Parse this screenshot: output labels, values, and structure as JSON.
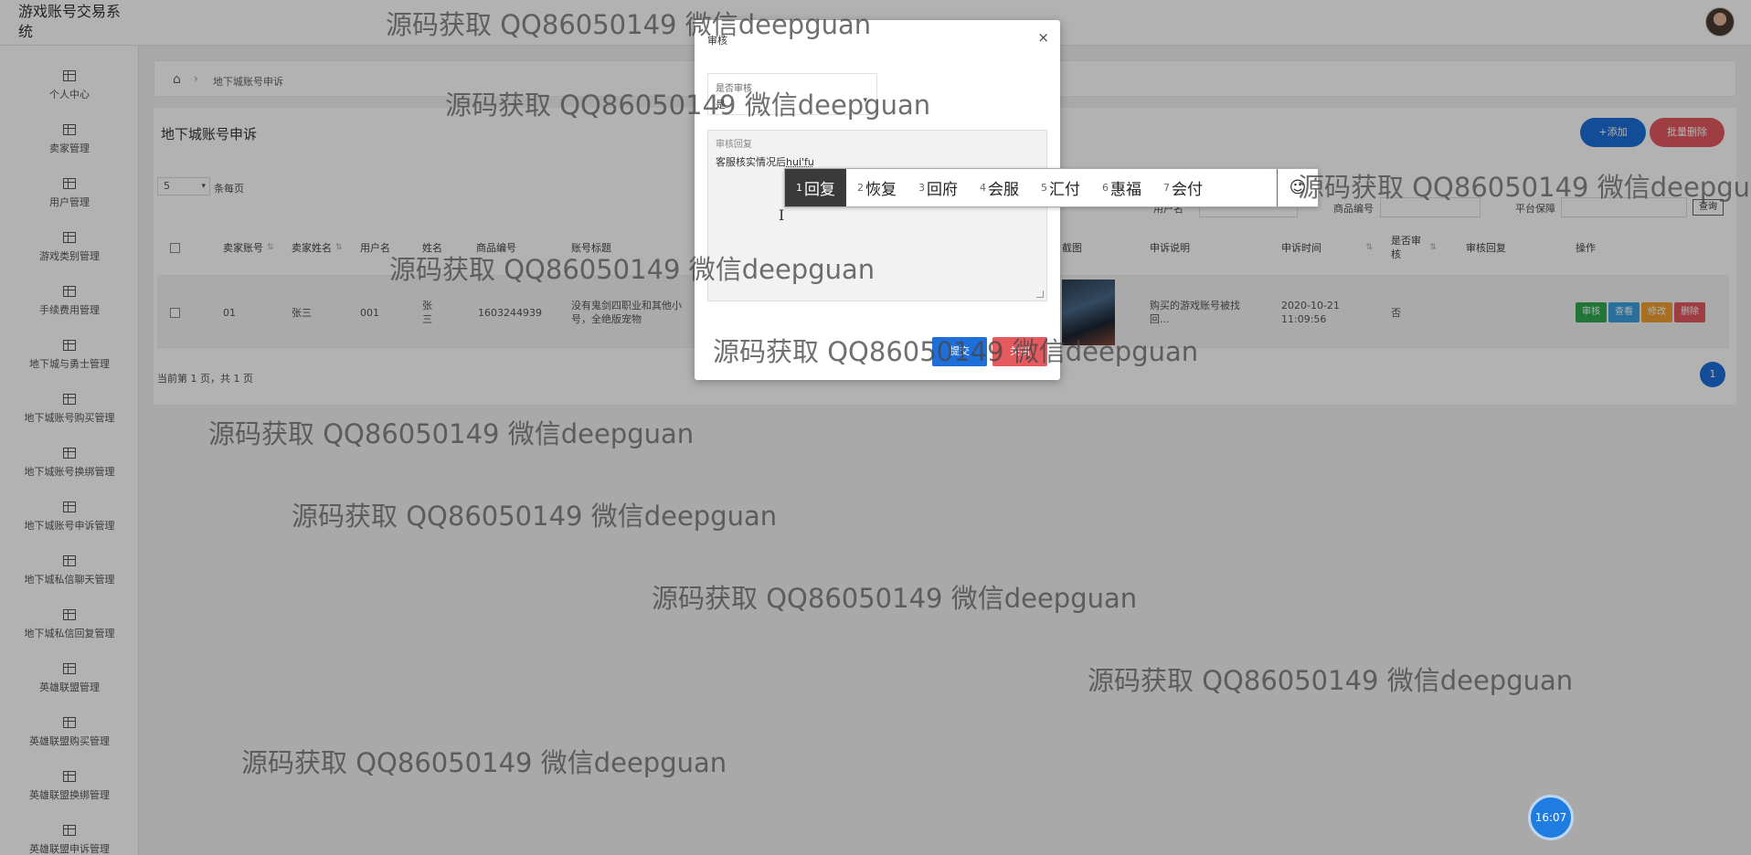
{
  "app": {
    "title": "游戏账号交易系统"
  },
  "sidebar": {
    "items": [
      {
        "label": "个人中心"
      },
      {
        "label": "卖家管理"
      },
      {
        "label": "用户管理"
      },
      {
        "label": "游戏类别管理"
      },
      {
        "label": "手续费用管理"
      },
      {
        "label": "地下城与勇士管理"
      },
      {
        "label": "地下城账号购买管理"
      },
      {
        "label": "地下城账号换绑管理"
      },
      {
        "label": "地下城账号申诉管理"
      },
      {
        "label": "地下城私信聊天管理"
      },
      {
        "label": "地下城私信回复管理"
      },
      {
        "label": "英雄联盟管理"
      },
      {
        "label": "英雄联盟购买管理"
      },
      {
        "label": "英雄联盟换绑管理"
      },
      {
        "label": "英雄联盟申诉管理"
      }
    ]
  },
  "breadcrumb": {
    "home_icon": "⌂",
    "separator": "›",
    "current": "地下城账号申诉"
  },
  "panel": {
    "title": "地下城账号申诉",
    "add_label": "+添加",
    "batch_delete_label": "批量删除",
    "page_size": "5",
    "page_size_label": "条每页"
  },
  "search": {
    "user_label": "用户名",
    "product_label": "商品编号",
    "platform_label": "平台保障",
    "query_label": "查询"
  },
  "table": {
    "headers": {
      "seller_account": "卖家账号",
      "seller_name": "卖家姓名",
      "username": "用户名",
      "name": "姓名",
      "product_no": "商品编号",
      "account_title": "账号标题",
      "screenshot": "截图",
      "complaint_desc": "申诉说明",
      "complaint_time": "申诉时间",
      "reviewed": "是否审核",
      "review_reply": "审核回复",
      "actions": "操作"
    },
    "rows": [
      {
        "seller_account": "01",
        "seller_name": "张三",
        "username": "001",
        "name": "张三",
        "product_no": "1603244939",
        "account_title": "没有鬼剑四职业和其他小号，全绝版宠物",
        "complaint_desc": "购买的游戏账号被找回...",
        "complaint_time": "2020-10-21 11:09:56",
        "reviewed": "否",
        "review_reply": ""
      }
    ],
    "action_labels": {
      "review": "审核",
      "view": "查看",
      "edit": "修改",
      "delete": "删除"
    }
  },
  "pager": {
    "summary": "当前第 1 页，共 1 页",
    "current": "1"
  },
  "dialog": {
    "title": "审核",
    "close_icon": "×",
    "reviewed_label": "是否审核",
    "reviewed_value": "是",
    "reply_label": "审核回复",
    "reply_value": "客服核实情况后",
    "reply_composing": "hui'fu",
    "submit_label": "提交",
    "cancel_label": "关闭"
  },
  "ime": {
    "candidates": [
      {
        "n": "1",
        "text": "回复"
      },
      {
        "n": "2",
        "text": "恢复"
      },
      {
        "n": "3",
        "text": "回府"
      },
      {
        "n": "4",
        "text": "会服"
      },
      {
        "n": "5",
        "text": "汇付"
      },
      {
        "n": "6",
        "text": "惠福"
      },
      {
        "n": "7",
        "text": "会付"
      }
    ],
    "emoji_icon": "☺"
  },
  "watermark": "源码获取 QQ86050149 微信deepguan",
  "clock": "16:07",
  "colors": {
    "primary": "#1e6fd9",
    "danger": "#e45a5f",
    "review": "#2fa84f",
    "view": "#3ba0e0",
    "edit": "#f0a030",
    "delete": "#e45a5f"
  }
}
